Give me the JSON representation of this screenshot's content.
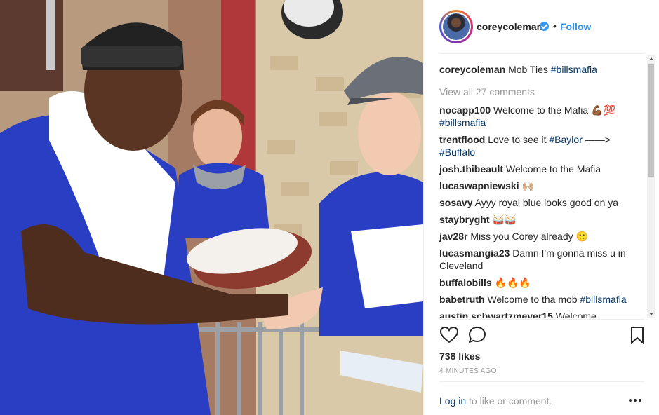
{
  "post": {
    "author": "coreycoleman",
    "follow_label": "Follow",
    "separator": "•",
    "caption": {
      "user": "coreycoleman",
      "text": "Mob Ties",
      "hashtag": "#billsmafia"
    },
    "view_all_comments": "View all 27 comments",
    "comments": [
      {
        "user": "nocapp100",
        "text": "Welcome to the Mafia 💪🏾💯",
        "tag": "#billsmafia"
      },
      {
        "user": "trentflood",
        "text": "Love to see it",
        "tag": "#Baylor",
        "text2": "——>",
        "tag2": "#Buffalo"
      },
      {
        "user": "josh.thibeault",
        "text": "Welcome to the Mafia"
      },
      {
        "user": "lucaswapniewski",
        "text": "🙌🏼"
      },
      {
        "user": "sosavy",
        "text": "Ayyy royal blue looks good on ya"
      },
      {
        "user": "staybryght",
        "text": "🥁🥁"
      },
      {
        "user": "jav28r",
        "text": "Miss you Corey already 🙁"
      },
      {
        "user": "lucasmangia23",
        "text": "Damn I'm gonna miss u in Cleveland"
      },
      {
        "user": "buffalobills",
        "text": "🔥🔥🔥"
      },
      {
        "user": "babetruth",
        "text": "Welcome to tha mob",
        "tag": "#billsmafia"
      },
      {
        "user": "austin.schwartzmeyer15",
        "text": "Welcome"
      }
    ],
    "likes": "738 likes",
    "timestamp": "4 MINUTES AGO",
    "login_link": "Log in",
    "login_text": "to like or comment."
  },
  "icons": [
    "verified-badge-icon",
    "heart-icon",
    "comment-icon",
    "bookmark-icon",
    "more-options-icon",
    "scroll-up-icon",
    "scroll-down-icon"
  ],
  "colors": {
    "link": "#3897f0",
    "hashtag": "#003569",
    "muted": "#999999",
    "text": "#262626",
    "jersey_blue": "#2a3ec4"
  }
}
